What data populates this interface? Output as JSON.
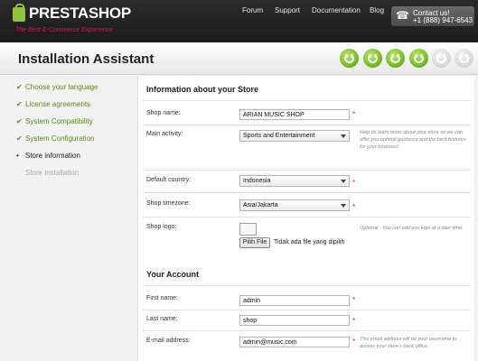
{
  "header": {
    "logo_text": "PRESTASHOP",
    "logo_tagline": "The Best E-Commerce Experience",
    "nav": [
      "Forum",
      "Support",
      "Documentation",
      "Blog"
    ],
    "contact_title": "Contact us!",
    "contact_phone": "+1 (888) 947-6543",
    "icon": "phone-icon"
  },
  "title": "Installation Assistant",
  "progress": {
    "completed": 4,
    "total": 6,
    "on_color": "#6fb31f",
    "off_color": "#d6d6d6"
  },
  "steps": [
    {
      "label": "Choose your language",
      "state": "done"
    },
    {
      "label": "License agreements",
      "state": "done"
    },
    {
      "label": "System Compatibility",
      "state": "done"
    },
    {
      "label": "System Configuration",
      "state": "done"
    },
    {
      "label": "Store information",
      "state": "current"
    },
    {
      "label": "Store installation",
      "state": "todo"
    }
  ],
  "store": {
    "heading": "Information about your Store",
    "shop_name_label": "Shop name:",
    "shop_name_value": "ARIAN MUSIC SHOP",
    "main_activity_label": "Main activity:",
    "main_activity_value": "Sports and Entertainment",
    "main_activity_hint": "Help us learn more about your store so we can offer you optimal guidance and the best features for your business!",
    "country_label": "Default country:",
    "country_value": "Indonesia",
    "timezone_label": "Shop timezone:",
    "timezone_value": "Asia/Jakarta",
    "logo_label": "Shop logo:",
    "logo_hint": "Optional - You can add you logo at a later time.",
    "file_button": "Pilih File",
    "file_status": "Tidak ada file yang dipilih"
  },
  "account": {
    "heading": "Your Account",
    "first_name_label": "First name:",
    "first_name_value": "admin",
    "last_name_label": "Last name:",
    "last_name_value": "shop",
    "email_label": "E-mail address:",
    "email_value": "admin@music.com",
    "email_hint": "This email address will be your username to access your store's back office."
  },
  "required_mark": "*",
  "colors": {
    "accent_green": "#5a8a1a",
    "required": "#e02020",
    "brand_pink": "#c9185a"
  }
}
